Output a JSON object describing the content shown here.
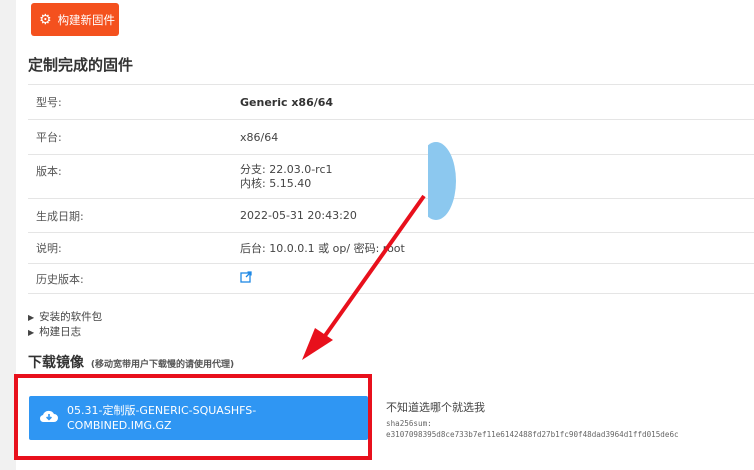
{
  "build_button": {
    "label": "构建新固件"
  },
  "section_title": "定制完成的固件",
  "info": [
    {
      "key": "型号:",
      "value": "Generic x86/64"
    },
    {
      "key": "平台:",
      "value": "x86/64"
    },
    {
      "key": "版本:",
      "value_lines": [
        "分支: 22.03.0-rc1",
        "内核: 5.15.40"
      ]
    },
    {
      "key": "生成日期:",
      "value": "2022-05-31 20:43:20"
    },
    {
      "key": "说明:",
      "value": "后台: 10.0.0.1 或 op/  密码: root"
    },
    {
      "key": "历史版本:",
      "icon": "external-link-icon"
    }
  ],
  "toggles": [
    "安装的软件包",
    "构建日志"
  ],
  "download": {
    "title": "下载镜像",
    "subtitle": "(移动宽带用户下载慢的请使用代理)",
    "button_line1": "05.31-定制版-GENERIC-SQUASHFS-",
    "button_line2": "COMBINED.IMG.GZ",
    "hint": "不知道选哪个就选我",
    "sha_label": "sha256sum:",
    "sha_value": "e3107098395d8ce733b7ef11e6142488fd27b1fc90f48dad3964d1ffd015de6c"
  },
  "colors": {
    "accent": "#f4511e",
    "download": "#2f96f3",
    "annotation": "#e8101c"
  }
}
